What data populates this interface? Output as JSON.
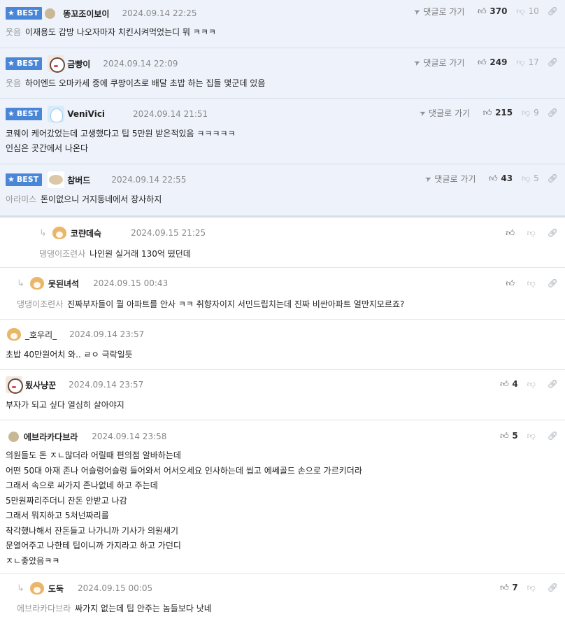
{
  "ui": {
    "best_label": "BEST",
    "goto_label": "댓글로 가기"
  },
  "comments": [
    {
      "nick": "똥꼬조이보이",
      "date": "2024.09.14 22:25",
      "prefix": "웃음",
      "text": "이재용도 감방 나오자마자 치킨시켜먹었는디 뭐 ㅋㅋㅋ",
      "up": "370",
      "down": "10"
    },
    {
      "nick": "금빵이",
      "date": "2024.09.14 22:09",
      "prefix": "웃음",
      "text": "하이엔드 오마카세 중에 쿠팡이츠로 배달 초밥 하는 집들 몇군데 있음",
      "up": "249",
      "down": "17"
    },
    {
      "nick": "VeniVici",
      "date": "2024.09.14 21:51",
      "lines": [
        "코웨이 케어갔었는데 고생했다고 팁 5만원 받은적있음 ㅋㅋㅋㅋㅋ",
        "인심은 곳간에서 나온다"
      ],
      "up": "215",
      "down": "9"
    },
    {
      "nick": "참버드",
      "date": "2024.09.14 22:55",
      "prefix": "아라미스",
      "text": "돈이없으니 거지동네에서 장사하지",
      "up": "43",
      "down": "5"
    },
    {
      "nick": "코랸데슥",
      "date": "2024.09.15 21:25",
      "prefix": "댕댕이조련사",
      "text": "나인원 실거래 130억 떴던데"
    },
    {
      "nick": "못된녀석",
      "date": "2024.09.15 00:43",
      "prefix": "댕댕이조련사",
      "text": "진짜부자들이 뭘 아파트를 안사 ㅋㅋ 취향자이지 서민드립치는데 진짜 비싼아파트 얼만지모르죠?"
    },
    {
      "nick": "_호우리_",
      "date": "2024.09.14 23:57",
      "text": "초밥 40만원어치 와.. ㄹㅇ 극락일듯"
    },
    {
      "nick": "됬사냥꾼",
      "date": "2024.09.14 23:57",
      "text": "부자가 되고 싶다 열심히 살아야지",
      "up": "4"
    },
    {
      "nick": "에브라카다브라",
      "date": "2024.09.14 23:58",
      "up": "5",
      "lines": [
        "의원들도 돈 ㅈㄴ많더라 어릴때 편의점 알바하는데",
        "어떤 50대 아재 존나 어슬렁어슬렁 들어와서 어서오세요 인사하는데 씹고 에쎄골드 손으로 가르키더라",
        "그래서 속으로 싸가지 존나없네 하고 주는데",
        "5만원짜리주더니 잔돈 안받고 나감",
        "그래서 뭐지하고 5처넌짜리를",
        "착각했나해서 잔돈들고 나가니까 기사가 의원새기",
        "문열어주고 나한테 팁이니까 가지라고 하고 가던디",
        "ㅈㄴ좋았음ㅋㅋ"
      ]
    },
    {
      "nick": "도둑",
      "date": "2024.09.15 00:05",
      "prefix": "에브라카다브라",
      "text": "싸가지 없는데 팁 안주는 놈들보다 낫네",
      "up": "7"
    }
  ]
}
